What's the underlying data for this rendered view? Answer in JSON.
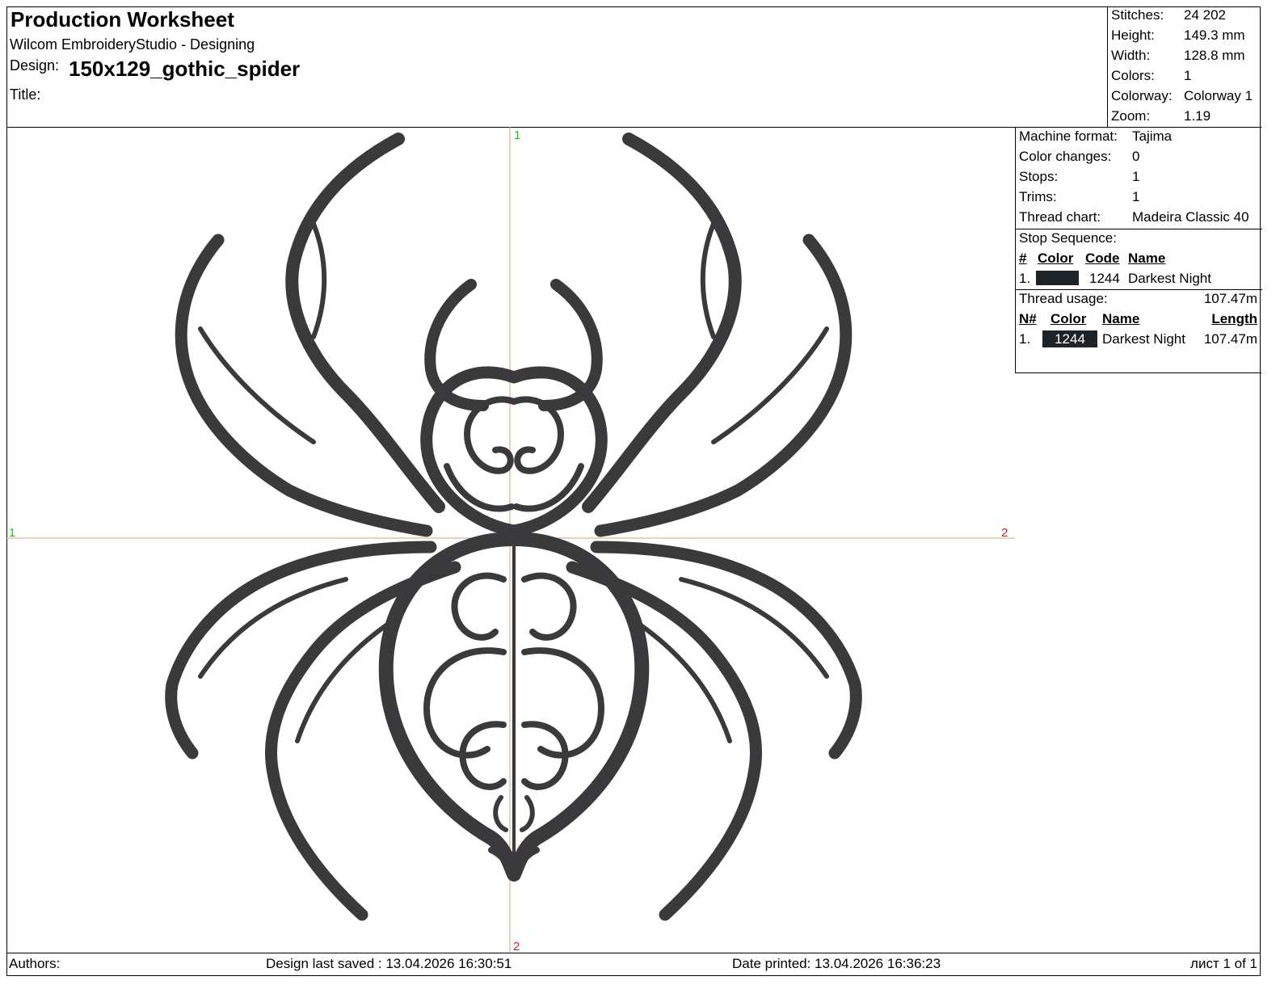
{
  "header": {
    "doc_title": "Production Worksheet",
    "app_name": "Wilcom EmbroideryStudio - Designing",
    "design_label": "Design:",
    "design_name": "150x129_gothic_spider",
    "title_label": "Title:"
  },
  "summary": {
    "stitches_label": "Stitches:",
    "stitches": "24 202",
    "height_label": "Height:",
    "height": "149.3 mm",
    "width_label": "Width:",
    "width": "128.8 mm",
    "colors_label": "Colors:",
    "colors": "1",
    "colorway_label": "Colorway:",
    "colorway": "Colorway 1",
    "zoom_label": "Zoom:",
    "zoom": "1.19"
  },
  "machine": {
    "format_label": "Machine format:",
    "format": "Tajima",
    "color_changes_label": "Color changes:",
    "color_changes": "0",
    "stops_label": "Stops:",
    "stops": "1",
    "trims_label": "Trims:",
    "trims": "1",
    "thread_chart_label": "Thread chart:",
    "thread_chart": "Madeira Classic 40"
  },
  "stop_sequence": {
    "title": "Stop Sequence:",
    "headers": {
      "num": "#",
      "color": "Color",
      "code": "Code",
      "name": "Name"
    },
    "rows": [
      {
        "num": "1.",
        "color": "#1e2327",
        "code": "1244",
        "name": "Darkest Night"
      }
    ]
  },
  "thread_usage": {
    "title": "Thread usage:",
    "total": "107.47m",
    "headers": {
      "num": "N#",
      "color": "Color",
      "name": "Name",
      "length": "Length"
    },
    "rows": [
      {
        "num": "1.",
        "code": "1244",
        "color": "#1e2327",
        "name": "Darkest Night",
        "length": "107.47m"
      }
    ]
  },
  "canvas": {
    "marker_top": "1",
    "marker_left": "1",
    "marker_right": "2",
    "marker_bottom": "2",
    "thread_color": "#3a3a3c",
    "axis_color": "#d4a373"
  },
  "footer": {
    "authors_label": "Authors:",
    "last_saved": "Design last saved : 13.04.2026 16:30:51",
    "date_printed": "Date printed: 13.04.2026 16:36:23",
    "page": "лист 1 of 1"
  }
}
